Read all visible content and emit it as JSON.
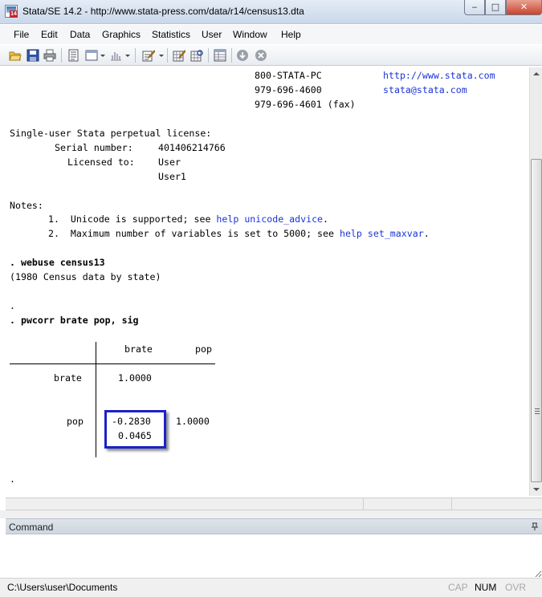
{
  "window": {
    "title": "Stata/SE 14.2 - http://www.stata-press.com/data/r14/census13.dta",
    "icon_badge": "14",
    "min_glyph": "‒",
    "max_glyph": "□",
    "close_glyph": "✕"
  },
  "menu": [
    "File",
    "Edit",
    "Data",
    "Graphics",
    "Statistics",
    "User",
    "Window",
    "Help"
  ],
  "toolbar": {
    "icons": [
      "open-icon",
      "save-icon",
      "print-icon",
      "log-icon",
      "viewer-icon",
      "graph-icon",
      "do-file-editor-icon",
      "data-editor-icon",
      "data-browser-icon",
      "variables-manager-icon",
      "break-icon",
      "clear-more-icon"
    ]
  },
  "results": {
    "header": {
      "phone_tollfree": "800-STATA-PC",
      "url": "http://www.stata.com",
      "phone": "979-696-4600",
      "email": "stata@stata.com",
      "fax": "979-696-4601 (fax)"
    },
    "license": {
      "heading": "Single-user Stata perpetual license:",
      "serial_label": "Serial number:",
      "serial_value": "401406214766",
      "licensed_label": "Licensed to:",
      "licensed_value1": "User",
      "licensed_value2": "User1"
    },
    "notes": {
      "heading": "Notes:",
      "note1_text": "1.  Unicode is supported; see ",
      "note1_link1": "help",
      "note1_link2": "unicode_advice",
      "note1_end": ".",
      "note2_text": "2.  Maximum number of variables is set to 5000; see ",
      "note2_link1": "help",
      "note2_link2": "set_maxvar",
      "note2_end": "."
    },
    "cmd1": ". webuse census13",
    "cmd1_output": "(1980 Census data by state)",
    "dot1": ".",
    "cmd2": ". pwcorr brate pop, sig",
    "table": {
      "col_headers": [
        "brate",
        "pop"
      ],
      "rows": [
        {
          "label": "brate",
          "corr": [
            "1.0000",
            ""
          ],
          "sig": [
            "",
            ""
          ]
        },
        {
          "label": "pop",
          "corr": [
            "-0.2830",
            "1.0000"
          ],
          "sig": [
            "0.0465",
            ""
          ]
        }
      ]
    },
    "dot_end": "."
  },
  "command_window": {
    "title": "Command",
    "pin_glyph": "⤒",
    "input_value": ""
  },
  "status": {
    "path": "C:\\Users\\user\\Documents",
    "cap": "CAP",
    "num": "NUM",
    "ovr": "OVR"
  }
}
